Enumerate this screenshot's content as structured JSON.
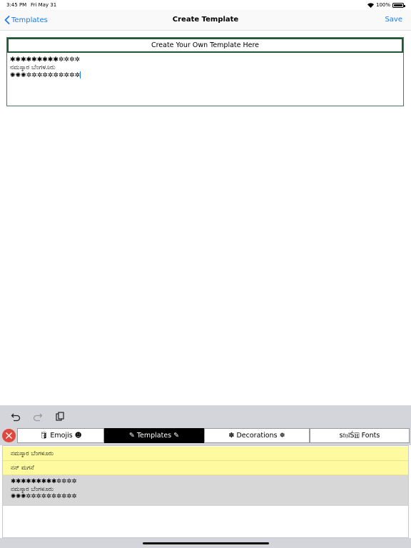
{
  "status": {
    "time": "3:45 PM",
    "date": "Fri May 31",
    "battery": "100%"
  },
  "nav": {
    "back_label": "Templates",
    "title": "Create Template",
    "save_label": "Save"
  },
  "editor": {
    "header": "Create Your Own Template Here",
    "text": "✱✱✱✱✱✱✱✱✱✲✲✲✲\nನಮಸ್ಕಾರ ಬೆಂಗಳೂರು\n✺✺✺✲✲✲✲✲✲✲✲✲✲"
  },
  "toolbar": {
    "icons": [
      "undo-icon",
      "redo-icon",
      "paste-icon"
    ]
  },
  "tabs": {
    "emojis": "🛢 Emojis ☻",
    "templates": "✎ Templates ✎",
    "decorations": "✽ Decorations ❅",
    "fonts": "s𝔱𝔶𝔩Ś🄷  Fonts"
  },
  "templates_list": [
    {
      "text": "ನಮಸ್ಕಾರ ಬೆಂಗಳೂರು",
      "style": "yellow"
    },
    {
      "text": "ನನ್ ಮಗನೆ",
      "style": "yellow"
    },
    {
      "text": "✱✱✱✱✱✱✱✱✱✲✲✲✲\nನಮಸ್ಕಾರ ಬೆಂಗಳೂರು\n✺✺✺✲✲✲✲✲✲✲✲✲✲",
      "style": "gray"
    }
  ],
  "colors": {
    "accent": "#1a7bf0",
    "editor_border": "#1d5a34",
    "close_button": "#e0483e",
    "active_tab": "#000000",
    "list_highlight": "#fdfaa0",
    "list_gray": "#d7d7d7",
    "keyboard_bg": "#d3d5db"
  }
}
